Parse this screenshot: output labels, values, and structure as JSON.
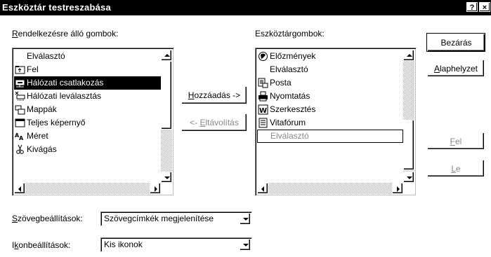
{
  "window": {
    "title": "Eszköztár testreszabása",
    "help_button": "?",
    "close_button": "×"
  },
  "available": {
    "label_u": "R",
    "label_rest": "endelkezésre álló gombok:",
    "items": [
      {
        "label": "Elválasztó",
        "icon": "none"
      },
      {
        "label": "Fel",
        "icon": "up-folder-icon"
      },
      {
        "label": "Hálózati csatlakozás",
        "icon": "map-network-drive-icon",
        "selected": true
      },
      {
        "label": "Hálózati leválasztás",
        "icon": "disconnect-network-drive-icon"
      },
      {
        "label": "Mappák",
        "icon": "folders-icon"
      },
      {
        "label": "Teljes képernyő",
        "icon": "full-screen-icon"
      },
      {
        "label": "Méret",
        "icon": "size-icon"
      },
      {
        "label": "Kivágás",
        "icon": "cut-scissors-icon"
      }
    ]
  },
  "current": {
    "label_pre": "Eszköztár",
    "label_u": "g",
    "label_rest": "ombok:",
    "items": [
      {
        "label": "Előzmények",
        "icon": "history-icon"
      },
      {
        "label": "Elválasztó",
        "icon": "none"
      },
      {
        "label": "Posta",
        "icon": "mail-icon"
      },
      {
        "label": "Nyomtatás",
        "icon": "print-icon"
      },
      {
        "label": "Szerkesztés",
        "icon": "edit-icon"
      },
      {
        "label": "Vitafórum",
        "icon": "discuss-icon"
      },
      {
        "label": "Elválasztó",
        "icon": "none",
        "focused": true
      }
    ]
  },
  "buttons": {
    "add_u": "H",
    "add_rest": "ozzáadás ->",
    "remove_pre": "<- ",
    "remove_u": "E",
    "remove_rest": "ltávolítás",
    "close": "Bezárás",
    "reset_u": "A",
    "reset_rest": "laphelyzet",
    "up_u": "F",
    "up_rest": "el",
    "down_u": "L",
    "down_rest": "e"
  },
  "options": {
    "text_label_u": "S",
    "text_label_rest": "zövegbeállítások:",
    "text_value": "Szövegcímkék megjelenítése",
    "icon_label_pre": "I",
    "icon_label_u": "k",
    "icon_label_rest": "onbeállítások:",
    "icon_value": "Kis ikonok"
  }
}
